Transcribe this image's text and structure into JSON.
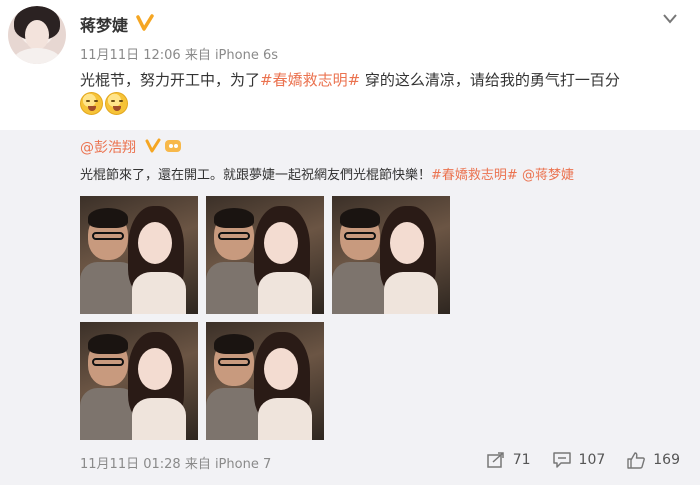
{
  "post": {
    "username": "蒋梦婕",
    "meta": "11月11日 12:06 来自 iPhone 6s",
    "content": {
      "before": "光棍节，努力开工中，为了",
      "tag": "#春嬌救志明#",
      "after": " 穿的这么清凉，请给我的勇气打一百分"
    },
    "emoji_count": 2
  },
  "repost": {
    "username": "@彭浩翔",
    "text": {
      "before": "光棍節來了，還在開工。就跟夢婕一起祝網友們光棍節快樂！",
      "tag": "#春嬌救志明#",
      "mention": " @蒋梦婕"
    },
    "photo_count": 5,
    "meta": "11月11日 01:28 来自 iPhone 7",
    "actions": {
      "share_count": "71",
      "comment_count": "107",
      "like_count": "169"
    }
  },
  "colors": {
    "accent": "#eb7350",
    "badge": "#f5a623",
    "repost_bg": "#f2f2f5",
    "meta_gray": "#8a8a8a"
  },
  "icons": [
    "avatar",
    "verified-badge-icon",
    "chevron-down-icon",
    "member-icon",
    "share-icon",
    "comment-icon",
    "like-icon"
  ]
}
